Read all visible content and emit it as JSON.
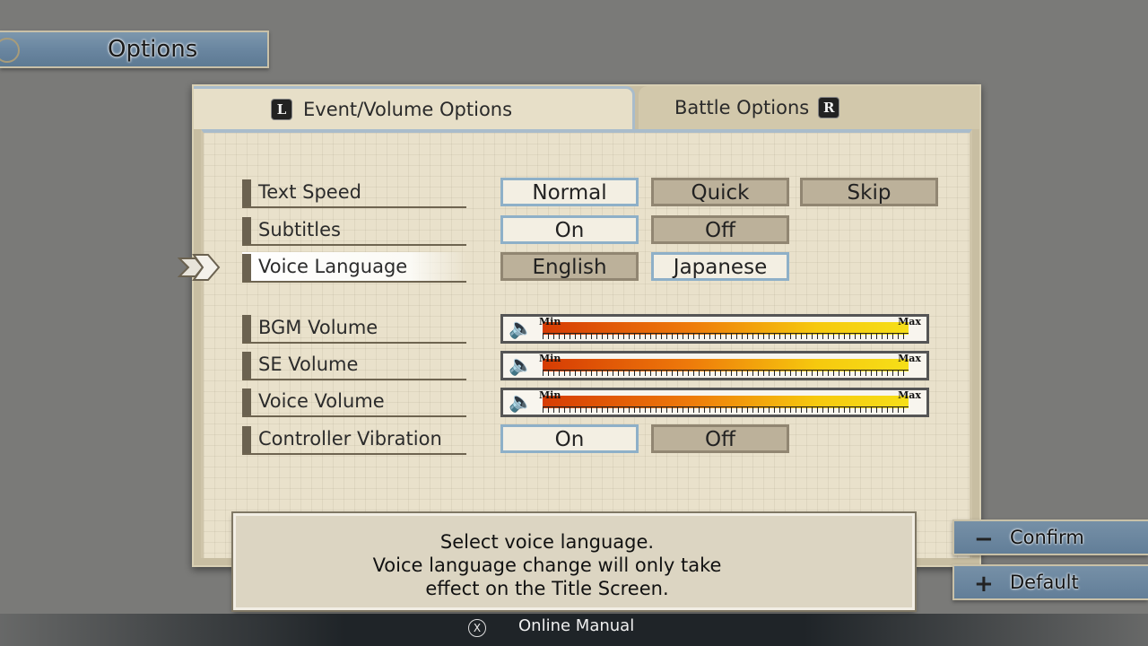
{
  "title": "Options",
  "tabs": {
    "active": {
      "glyph": "L",
      "label": "Event/Volume Options"
    },
    "inactive": {
      "label": "Battle Options",
      "glyph": "R"
    }
  },
  "rows": {
    "text_speed": {
      "label": "Text Speed",
      "options": [
        "Normal",
        "Quick",
        "Skip"
      ],
      "selected": "Normal"
    },
    "subtitles": {
      "label": "Subtitles",
      "options": [
        "On",
        "Off"
      ],
      "selected": "On"
    },
    "voice_language": {
      "label": "Voice Language",
      "options": [
        "English",
        "Japanese"
      ],
      "selected": "Japanese"
    },
    "bgm_volume": {
      "label": "BGM Volume",
      "min": "Min",
      "max": "Max",
      "level": 1.0
    },
    "se_volume": {
      "label": "SE Volume",
      "min": "Min",
      "max": "Max",
      "level": 1.0
    },
    "voice_volume": {
      "label": "Voice Volume",
      "min": "Min",
      "max": "Max",
      "level": 1.0
    },
    "controller_vibration": {
      "label": "Controller Vibration",
      "options": [
        "On",
        "Off"
      ],
      "selected": "On"
    }
  },
  "help": {
    "line1": "Select voice language.",
    "line2": "Voice language change will only take",
    "line3": "effect on the Title Screen."
  },
  "side_buttons": {
    "confirm": {
      "glyph": "−",
      "label": "Confirm"
    },
    "default": {
      "glyph": "+",
      "label": "Default"
    }
  },
  "footer": {
    "glyph": "X",
    "label": "Online Manual"
  },
  "colors": {
    "accent_blue": "#6a86a0",
    "selected_border": "#8eb0c8",
    "paper": "#e9e1cb"
  }
}
